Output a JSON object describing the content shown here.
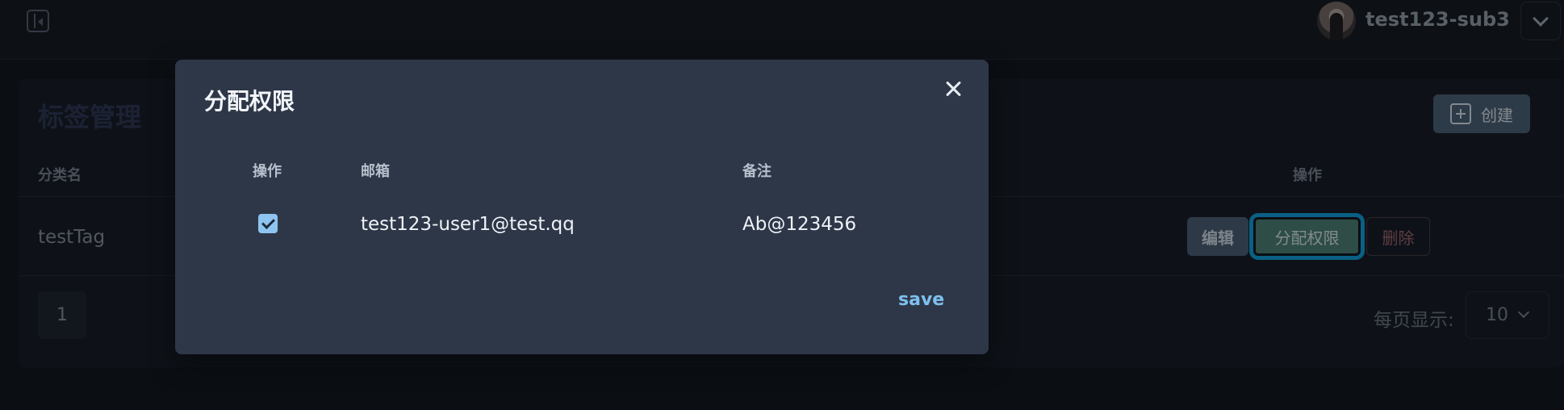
{
  "header": {
    "username": "test123-sub3"
  },
  "page": {
    "title": "标签管理",
    "create_label": "创建",
    "columns": {
      "category": "分类名",
      "actions": "操作"
    },
    "rows": [
      {
        "tag": "testTag",
        "edit_label": "编辑",
        "assign_label": "分配权限",
        "delete_label": "删除"
      }
    ],
    "pagination": {
      "current_page": "1",
      "per_page_label": "每页显示:",
      "per_page_value": "10"
    }
  },
  "modal": {
    "title": "分配权限",
    "columns": {
      "action": "操作",
      "email": "邮箱",
      "note": "备注"
    },
    "rows": [
      {
        "checked": true,
        "email": "test123-user1@test.qq",
        "note": "Ab@123456"
      }
    ],
    "save_label": "save"
  },
  "colors": {
    "accent": "#0ca7e6",
    "assign_button": "#4b8476",
    "modal_bg": "#2e3748"
  },
  "icons": [
    "sidebar-toggle-icon",
    "avatar",
    "chevron-down-icon",
    "plus-square-icon",
    "close-icon",
    "checkbox-checked-icon"
  ]
}
